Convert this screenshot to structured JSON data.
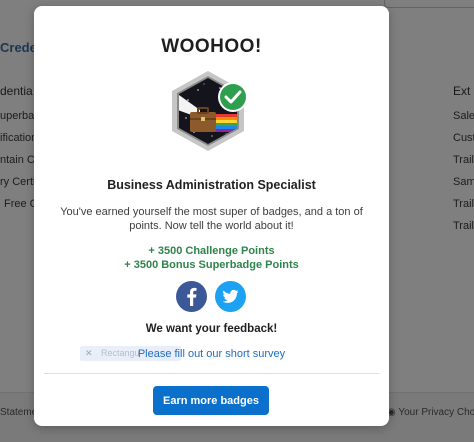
{
  "background": {
    "credentials_title": "Creder",
    "left_column_heading": "dentia",
    "left_column_items": [
      "uperbadge",
      "ification",
      "ntain C",
      "ry Certif",
      "Free C"
    ],
    "right_column_heading": "Ext",
    "right_column_items": [
      "Sale",
      "Cust",
      "Trail",
      "Sam",
      "Trail",
      "Trail"
    ],
    "footer_left": "Stateme",
    "footer_right": "Your Privacy Choic"
  },
  "modal": {
    "title": "WOOHOO!",
    "badge_name": "Business Administration Specialist",
    "message": "You've earned yourself the most super of badges, and a ton of points. Now tell the world about it!",
    "points": [
      "+ 3500 Challenge Points",
      "+ 3500 Bonus Superbadge Points"
    ],
    "feedback_heading": "We want your feedback!",
    "survey_chip_text": "Rectangu",
    "survey_link": "Please fill out our short survey",
    "earn_button": "Earn more badges"
  },
  "icons": {
    "badge": "superbadge-briefcase-icon",
    "check": "check-icon",
    "facebook": "facebook-icon",
    "twitter": "twitter-icon"
  },
  "colors": {
    "points_green": "#2e844a",
    "link_blue": "#1d6fc1",
    "button_blue": "#0b6fcc",
    "check_green": "#2e9e4f",
    "facebook": "#3b5998",
    "twitter": "#1da1f2"
  }
}
